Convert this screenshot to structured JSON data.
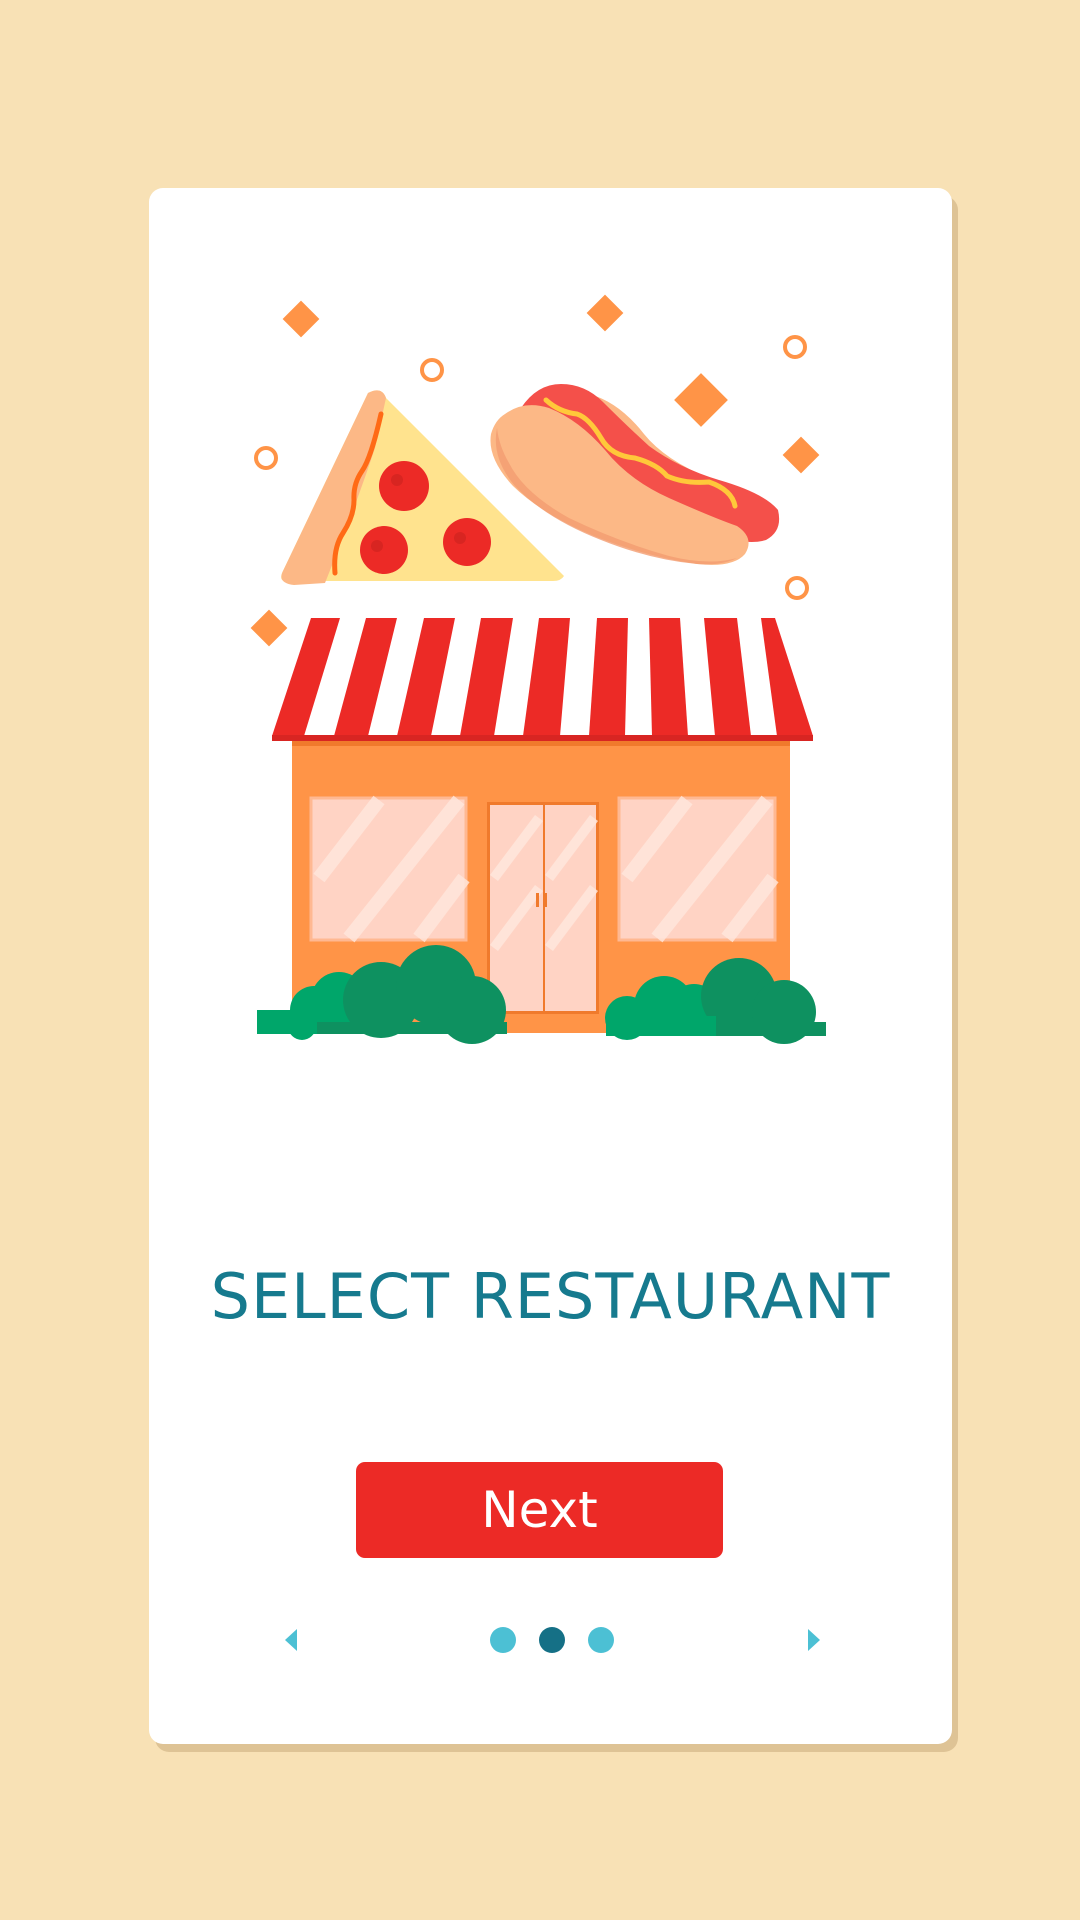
{
  "colors": {
    "background": "#F8E1B5",
    "card": "#FFFFFF",
    "title": "#167A8E",
    "button": "#EC2A26",
    "button_text": "#FFFFFF",
    "dot_inactive": "#4CC0D4",
    "dot_active": "#157086",
    "arrow": "#4CC0D4",
    "awning_red": "#EC2A26",
    "store_orange": "#FF9447",
    "bush_green": "#0E9160"
  },
  "illustration": {
    "icons": [
      "pizza-slice-icon",
      "hot-dog-icon",
      "restaurant-storefront-icon",
      "confetti-decoration"
    ]
  },
  "onboarding": {
    "title": "SELECT RESTAURANT",
    "next_label": "Next"
  },
  "pagination": {
    "prev_icon": "chevron-left-icon",
    "next_icon": "chevron-right-icon",
    "total_pages": 3,
    "active_page": 2
  }
}
